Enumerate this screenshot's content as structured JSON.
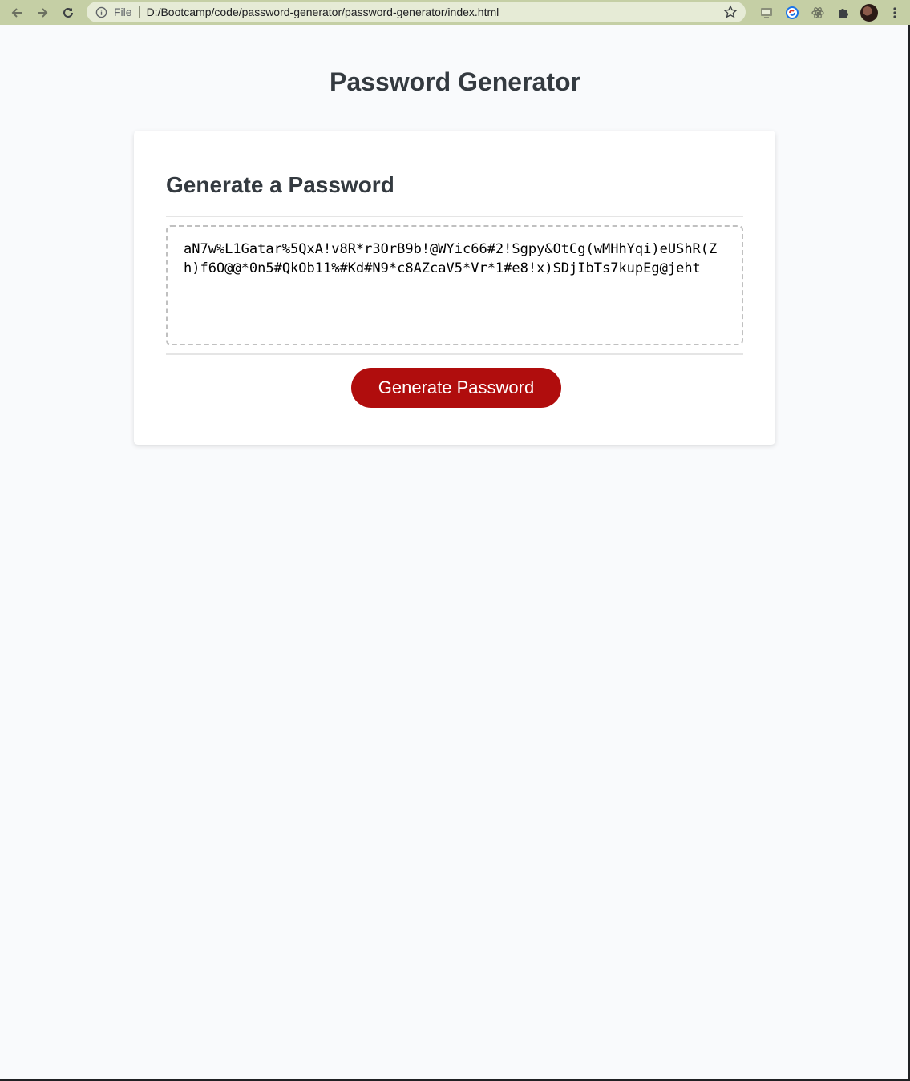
{
  "browser": {
    "file_label": "File",
    "url": "D:/Bootcamp/code/password-generator/password-generator/index.html",
    "colors": {
      "toolbar": "#c5cfa5",
      "omnibox": "#e6ebd6"
    }
  },
  "page": {
    "title": "Password Generator"
  },
  "card": {
    "title": "Generate a Password",
    "password": "aN7w%L1Gatar%5QxA!v8R*r3OrB9b!@WYic66#2!Sgpy&OtCg(wMHhYqi)eUShR(Zh)f6O@@*0n5#QkOb11%#Kd#N9*c8AZcaV5*Vr*1#e8!x)SDjIbTs7kupEg@jeht",
    "button_label": "Generate Password"
  },
  "colors": {
    "background": "#f9fafc",
    "accent": "#b00d0d",
    "heading": "#343a40"
  }
}
